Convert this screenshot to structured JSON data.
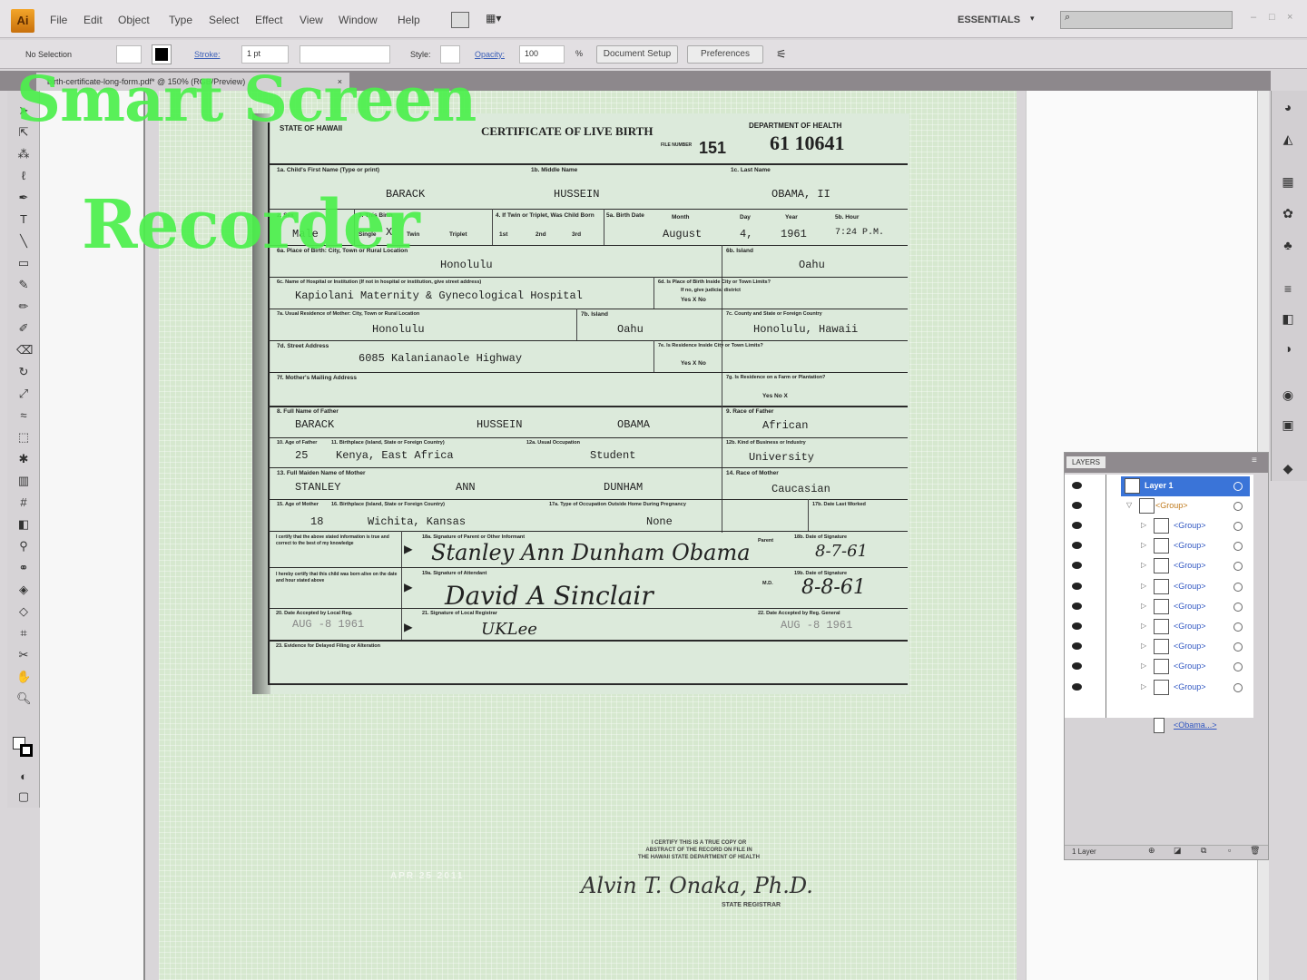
{
  "app": {
    "logo": "Ai",
    "menu": [
      "File",
      "Edit",
      "Object",
      "Type",
      "Select",
      "Effect",
      "View",
      "Window",
      "Help"
    ],
    "workspace": "ESSENTIALS",
    "window_controls": [
      "–",
      "□",
      "×"
    ]
  },
  "control": {
    "selection": "No Selection",
    "stroke_label": "Stroke:",
    "stroke_weight": "1 pt",
    "style_label": "Style:",
    "opacity_label": "Opacity:",
    "opacity_value": "100",
    "percent": "%",
    "document_setup": "Document Setup",
    "preferences": "Preferences"
  },
  "doc_tab": {
    "title": "birth-certificate-long-form.pdf* @ 150% (RGB/Preview)",
    "close": "×"
  },
  "watermark": {
    "line1": "Smart Screen",
    "line2": "Recorder"
  },
  "cert": {
    "state": "STATE OF HAWAII",
    "title": "CERTIFICATE OF LIVE BIRTH",
    "dept": "DEPARTMENT OF HEALTH",
    "number": "61 10641",
    "file_label": "FILE NUMBER",
    "file_no": "151",
    "l1a": "1a. Child's First Name (Type or print)",
    "l1b": "1b. Middle Name",
    "l1c": "1c. Last Name",
    "first": "BARACK",
    "middle": "HUSSEIN",
    "last": "OBAMA, II",
    "l2": "2. Sex",
    "sex": "Male",
    "l3": "3. This Birth",
    "single": "Single",
    "x": "X",
    "twin": "Twin",
    "triplet": "Triplet",
    "l4": "4. If Twin or Triplet, Was Child Born",
    "b1": "1st",
    "b2": "2nd",
    "b3": "3rd",
    "l5": "5a. Birth Date",
    "month_l": "Month",
    "day_l": "Day",
    "year_l": "Year",
    "hour_l": "5b. Hour",
    "month": "August",
    "day": "4,",
    "year": "1961",
    "hour": "7:24 P.M.",
    "l6a": "6a. Place of Birth: City, Town or Rural Location",
    "pob": "Honolulu",
    "l6b": "6b. Island",
    "island": "Oahu",
    "l6c": "6c. Name of Hospital or Institution (If not in hospital or institution, give street address)",
    "hospital": "Kapiolani Maternity & Gynecological Hospital",
    "l6d": "6d. Is Place of Birth Inside City or Town Limits?",
    "l6d2": "If no, give judicial district",
    "yesno": "Yes X  No",
    "l7a": "7a. Usual Residence of Mother: City, Town or Rural Location",
    "res_city": "Honolulu",
    "l7b": "7b. Island",
    "res_island": "Oahu",
    "l7c": "7c. County and State or Foreign Country",
    "res_county": "Honolulu, Hawaii",
    "l7d": "7d. Street Address",
    "street": "6085 Kalanianaole Highway",
    "l7e": "7e. Is Residence Inside City or Town Limits?",
    "l7f": "7f. Mother's Mailing Address",
    "l7g": "7g. Is Residence on a Farm or Plantation?",
    "farm": "Yes   No X",
    "l8": "8. Full Name of Father",
    "f_first": "BARACK",
    "f_middle": "HUSSEIN",
    "f_last": "OBAMA",
    "l9": "9. Race of Father",
    "f_race": "African",
    "l10": "10. Age of Father",
    "f_age": "25",
    "l11": "11. Birthplace (Island, State or Foreign Country)",
    "f_birth": "Kenya, East Africa",
    "l12a": "12a. Usual Occupation",
    "f_occ": "Student",
    "l12b": "12b. Kind of Business or Industry",
    "f_ind": "University",
    "l13": "13. Full Maiden Name of Mother",
    "m_first": "STANLEY",
    "m_middle": "ANN",
    "m_last": "DUNHAM",
    "l14": "14. Race of Mother",
    "m_race": "Caucasian",
    "l15": "15. Age of Mother",
    "m_age": "18",
    "l16": "16. Birthplace (Island, State or Foreign Country)",
    "m_birth": "Wichita, Kansas",
    "l17a": "17a. Type of Occupation Outside Home During Pregnancy",
    "m_occ": "None",
    "l17b": "17b. Date Last Worked",
    "cert1": "I certify that the above stated information is true and correct to the best of my knowledge",
    "l18a": "18a. Signature of Parent or Other Informant",
    "sig_parent": "Stanley Ann Dunham Obama",
    "parent": "Parent",
    "l18b": "18b. Date of Signature",
    "d18": "8-7-61",
    "cert2": "I hereby certify that this child was born alive on the date and hour stated above",
    "l19a": "19a. Signature of Attendant",
    "sig_att": "David A Sinclair",
    "md": "M.D.",
    "l19b": "19b. Date of Signature",
    "d19": "8-8-61",
    "l20": "20. Date Accepted by Local Reg.",
    "d20": "AUG -8 1961",
    "l21": "21. Signature of Local Registrar",
    "sig_reg": "UKLee",
    "l22": "22. Date Accepted by Reg. General",
    "d22": "AUG -8 1961",
    "l23": "23. Evidence for Delayed Filing or Alteration",
    "foot1": "I CERTIFY THIS IS A TRUE COPY OR",
    "foot2": "ABSTRACT OF THE RECORD ON FILE IN",
    "foot3": "THE HAWAII STATE DEPARTMENT OF HEALTH",
    "registrar_sig": "Alvin T. Onaka, Ph.D.",
    "registrar": "STATE REGISTRAR",
    "stamp": "APR 25 2011"
  },
  "layers": {
    "title": "LAYERS",
    "layer": "Layer 1",
    "group": "<Group>",
    "items": [
      "<Group>",
      "<Group>",
      "<Group>",
      "<Group>",
      "<Group>",
      "<Group>",
      "<Group>",
      "<Group>",
      "<Group>"
    ],
    "last": "<Obama...>",
    "footer": "1 Layer"
  }
}
